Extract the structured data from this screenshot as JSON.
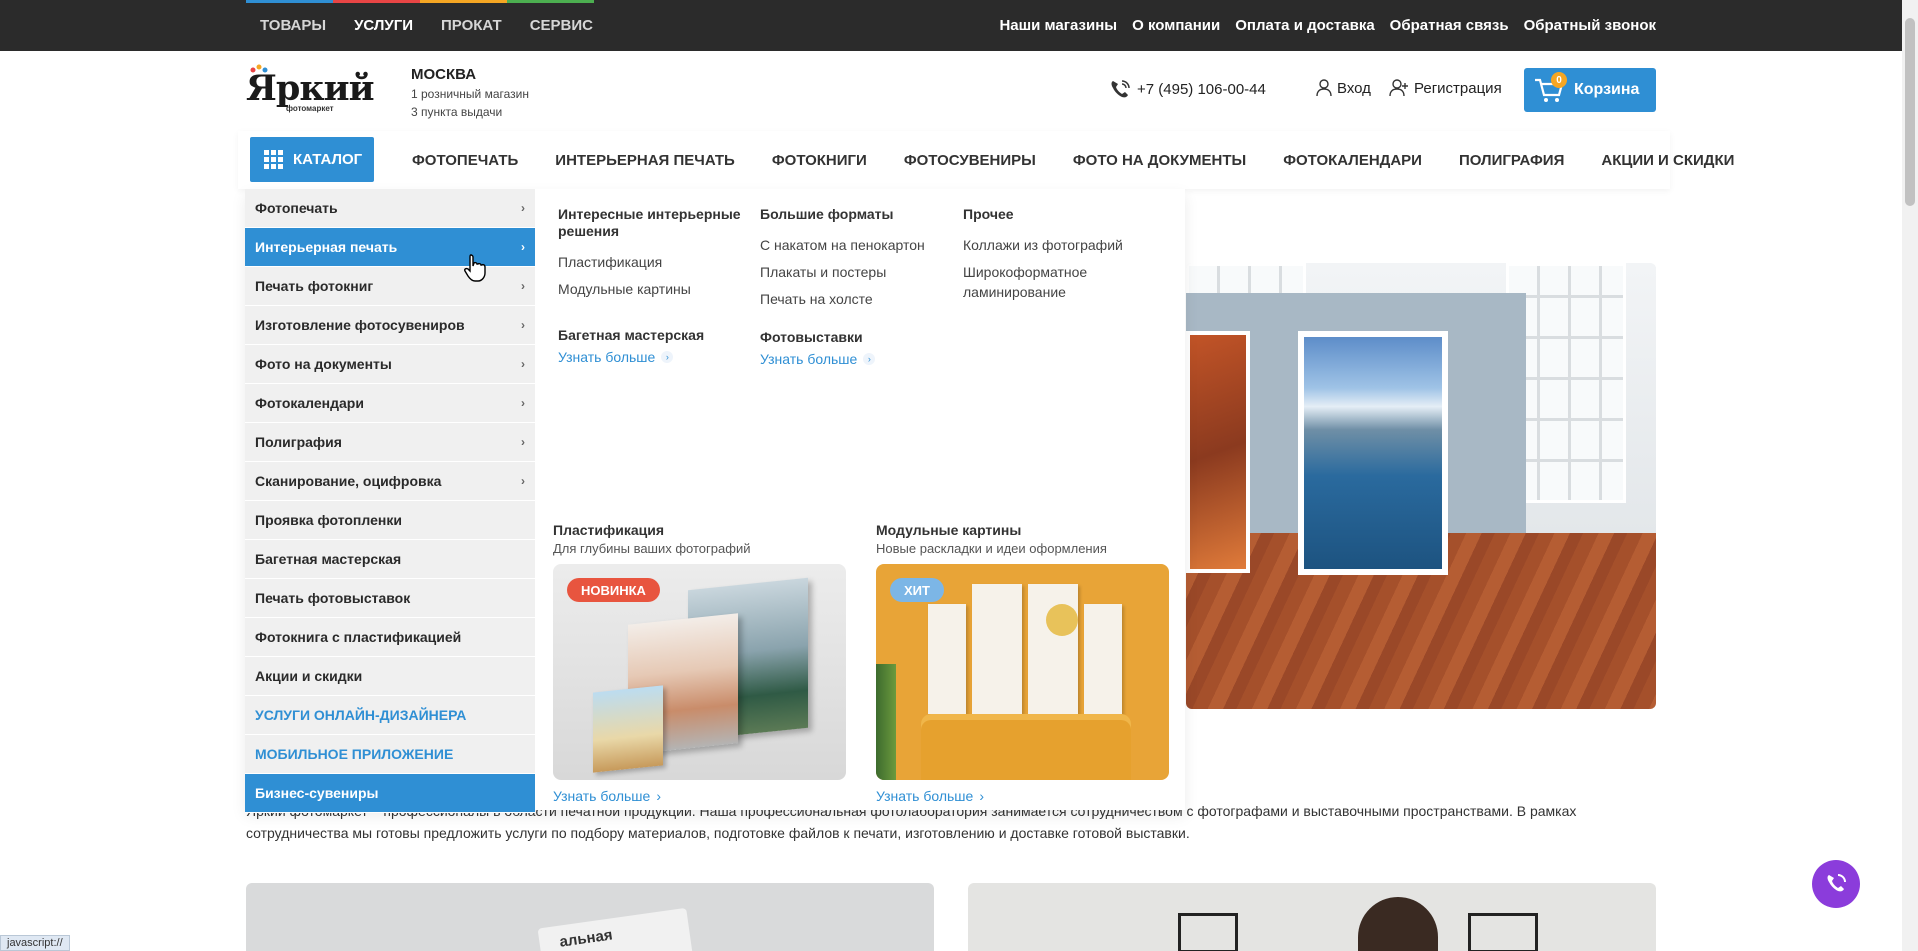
{
  "topbar": {
    "nav": [
      "ТОВАРЫ",
      "УСЛУГИ",
      "ПРОКАТ",
      "СЕРВИС"
    ],
    "active_index": 1,
    "stripe_colors": [
      "#2f8fd4",
      "#e84545",
      "#f5a623",
      "#4caf50"
    ],
    "links": [
      "Наши магазины",
      "О компании",
      "Оплата и доставка",
      "Обратная связь",
      "Обратный звонок"
    ]
  },
  "header": {
    "logo_text": "Яркий",
    "logo_sub": "фотомаркет",
    "city": "МОСКВА",
    "city_line1": "1 розничный магазин",
    "city_line2": "3 пункта выдачи",
    "phone": "+7 (495) 106-00-44",
    "login": "Вход",
    "register": "Регистрация",
    "cart_label": "Корзина",
    "cart_count": "0"
  },
  "mainnav": {
    "catalog": "КАТАЛОГ",
    "items": [
      "ФОТОПЕЧАТЬ",
      "ИНТЕРЬЕРНАЯ ПЕЧАТЬ",
      "ФОТОКНИГИ",
      "ФОТОСУВЕНИРЫ",
      "ФОТО НА ДОКУМЕНТЫ",
      "ФОТОКАЛЕНДАРИ",
      "ПОЛИГРАФИЯ",
      "АКЦИИ И СКИДКИ"
    ]
  },
  "sidemenu": {
    "items": [
      {
        "label": "Фотопечать",
        "arrow": true
      },
      {
        "label": "Интерьерная печать",
        "arrow": true,
        "active": true
      },
      {
        "label": "Печать фотокниг",
        "arrow": true
      },
      {
        "label": "Изготовление фотосувениров",
        "arrow": true
      },
      {
        "label": "Фото на документы",
        "arrow": true
      },
      {
        "label": "Фотокалендари",
        "arrow": true
      },
      {
        "label": "Полиграфия",
        "arrow": true
      },
      {
        "label": "Сканирование, оцифровка",
        "arrow": true
      },
      {
        "label": "Проявка фотопленки"
      },
      {
        "label": "Багетная мастерская"
      },
      {
        "label": "Печать фотовыставок"
      },
      {
        "label": "Фотокнига с пластификацией"
      },
      {
        "label": "Акции и скидки"
      },
      {
        "label": "УСЛУГИ ОНЛАЙН-ДИЗАЙНЕРА",
        "link": true
      },
      {
        "label": "МОБИЛЬНОЕ ПРИЛОЖЕНИЕ",
        "link": true
      },
      {
        "label": "Бизнес-сувениры",
        "bottom": true
      }
    ],
    "arrow_glyph": "›"
  },
  "submenu": {
    "col1": {
      "head": "Интересные интерьерные решения",
      "items": [
        "Пластификация",
        "Модульные картины"
      ],
      "head2": "Багетная мастерская",
      "more2": "Узнать больше"
    },
    "col2": {
      "head": "Большие форматы",
      "items": [
        "С накатом на пенокартон",
        "Плакаты и постеры",
        "Печать на холсте"
      ],
      "head2": "Фотовыставки",
      "more2": "Узнать больше"
    },
    "col3": {
      "head": "Прочее",
      "items": [
        "Коллажи из фотографий",
        "Широкоформатное ламинирование"
      ]
    }
  },
  "cards": [
    {
      "title": "Пластификация",
      "subtitle": "Для глубины ваших фотографий",
      "tag": "НОВИНКА",
      "tag_color": "#e8553f",
      "more": "Узнать больше"
    },
    {
      "title": "Модульные картины",
      "subtitle": "Новые раскладки и идеи оформления",
      "tag": "ХИТ",
      "tag_color": "#7cb6e6",
      "more": "Узнать больше"
    }
  ],
  "page": {
    "body_line1": "Яркий фотомаркет – профессионалы в области печатной продукции. Наша профессиональная фотолаборатория занимается сотрудничеством с фотографами и выставочными пространствами. В рамках",
    "body_line2": "сотрудничества мы готовы предложить услуги по подбору материалов, подготовке файлов к печати, изготовлению и доставке готовой выставки.",
    "tile_text": "альная"
  },
  "status_bar": "javascript://",
  "colors": {
    "accent": "#2f8fd4",
    "call_button": "#8b3cdb",
    "topbar": "#2b2b2b"
  }
}
